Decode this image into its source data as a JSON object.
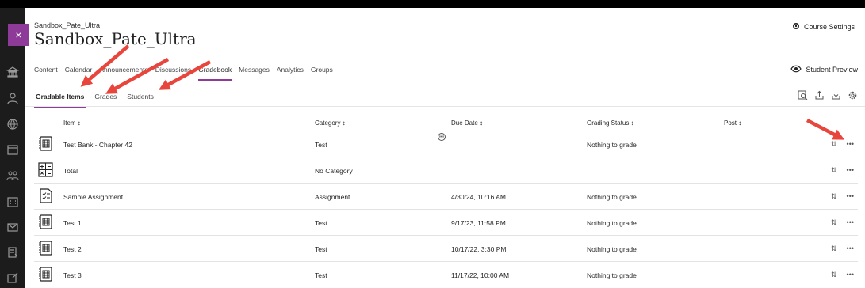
{
  "course": {
    "small_name": "Sandbox_Pate_Ultra",
    "title": "Sandbox_Pate_Ultra",
    "settings_label": "Course Settings",
    "close_label": "×"
  },
  "nav": {
    "tabs": [
      {
        "label": "Content"
      },
      {
        "label": "Calendar"
      },
      {
        "label": "Announcements"
      },
      {
        "label": "Discussions"
      },
      {
        "label": "Gradebook"
      },
      {
        "label": "Messages"
      },
      {
        "label": "Analytics"
      },
      {
        "label": "Groups"
      }
    ],
    "active_tab": "Gradebook",
    "student_preview_label": "Student Preview"
  },
  "subnav": {
    "tabs": [
      {
        "label": "Gradable Items"
      },
      {
        "label": "Grades"
      },
      {
        "label": "Students"
      }
    ],
    "active_tab": "Gradable Items"
  },
  "toolbar": {
    "icons": [
      "search-grades-icon",
      "upload-icon",
      "download-icon",
      "settings-gear-icon"
    ]
  },
  "table": {
    "headers": {
      "item": "Item ↕",
      "category": "Category ↕",
      "due_date": "Due Date ↕",
      "grading_status": "Grading Status ↕",
      "post": "Post ↕"
    },
    "add_icon": "⊕",
    "rows": [
      {
        "icon": "test-icon",
        "item": "Test Bank - Chapter 42",
        "category": "Test",
        "due_date": "",
        "grading_status": "Nothing to grade"
      },
      {
        "icon": "calculation-icon",
        "item": "Total",
        "category": "No Category",
        "due_date": "",
        "grading_status": ""
      },
      {
        "icon": "assignment-icon",
        "item": "Sample Assignment",
        "category": "Assignment",
        "due_date": "4/30/24, 10:16 AM",
        "grading_status": "Nothing to grade"
      },
      {
        "icon": "test-icon",
        "item": "Test 1",
        "category": "Test",
        "due_date": "9/17/23, 11:58 PM",
        "grading_status": "Nothing to grade"
      },
      {
        "icon": "test-icon",
        "item": "Test 2",
        "category": "Test",
        "due_date": "10/17/22, 3:30 PM",
        "grading_status": "Nothing to grade"
      },
      {
        "icon": "test-icon",
        "item": "Test 3",
        "category": "Test",
        "due_date": "11/17/22, 10:00 AM",
        "grading_status": "Nothing to grade"
      }
    ],
    "reorder_glyph": "⇅",
    "more_glyph": "•••"
  },
  "colors": {
    "accent": "#8d3a98",
    "annotation_arrow": "#e8453c",
    "rail": "#1c1c1c"
  }
}
